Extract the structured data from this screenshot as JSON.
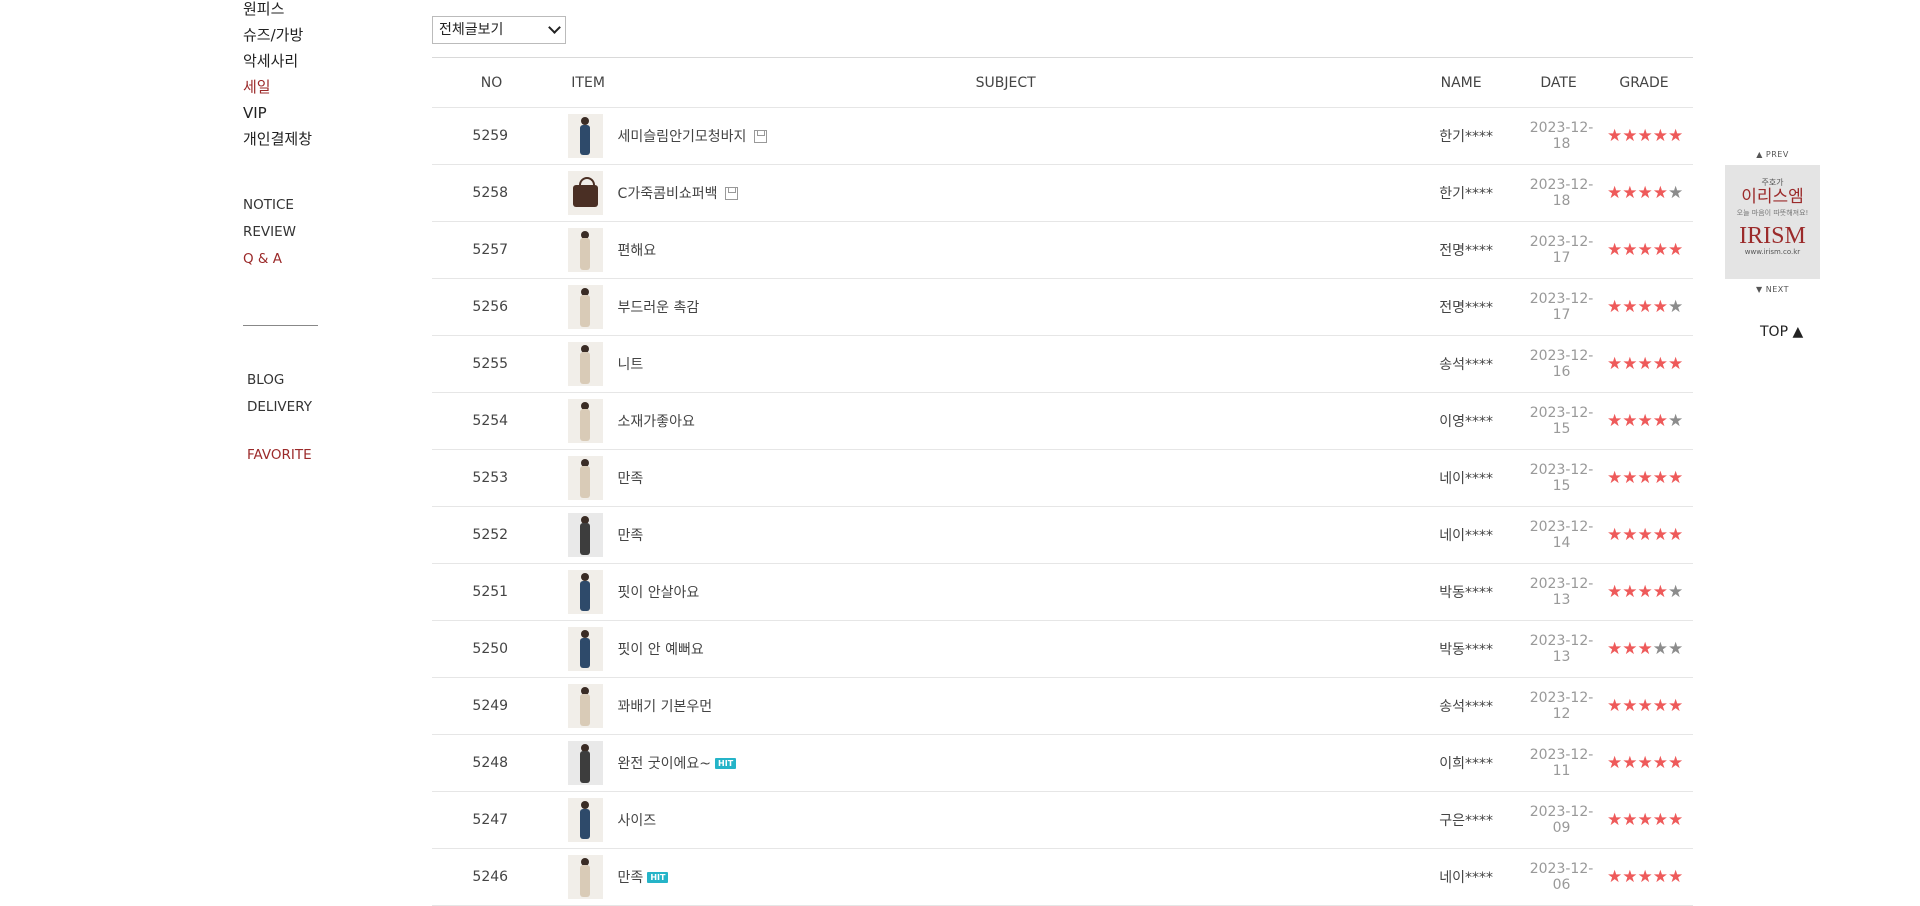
{
  "nav": {
    "categories": [
      {
        "label": "원피스",
        "highlight": false
      },
      {
        "label": "슈즈/가방",
        "highlight": false
      },
      {
        "label": "악세사리",
        "highlight": false
      },
      {
        "label": "세일",
        "highlight": true
      },
      {
        "label": "VIP",
        "highlight": false
      },
      {
        "label": "개인결제창",
        "highlight": false
      }
    ],
    "board_links": [
      {
        "label": "NOTICE",
        "highlight": false
      },
      {
        "label": "REVIEW",
        "highlight": false
      },
      {
        "label": "Q & A",
        "highlight": true
      }
    ],
    "extra_links": [
      "BLOG",
      "DELIVERY"
    ],
    "favorite": "FAVORITE"
  },
  "filter": {
    "selected": "전체글보기"
  },
  "table": {
    "headers": {
      "no": "NO",
      "item": "ITEM",
      "subject": "SUBJECT",
      "name": "NAME",
      "date": "DATE",
      "grade": "GRADE"
    },
    "rows": [
      {
        "no": "5259",
        "thumb": "pants",
        "subject": "세미슬림안기모청바지",
        "file": true,
        "hit": false,
        "name": "한기****",
        "date": "2023-12-18",
        "rating": 5
      },
      {
        "no": "5258",
        "thumb": "bag",
        "subject": "C가죽콤비쇼퍼백",
        "file": true,
        "hit": false,
        "name": "한기****",
        "date": "2023-12-18",
        "rating": 4
      },
      {
        "no": "5257",
        "thumb": "beige",
        "subject": "편해요",
        "file": false,
        "hit": false,
        "name": "전명****",
        "date": "2023-12-17",
        "rating": 5
      },
      {
        "no": "5256",
        "thumb": "beige",
        "subject": "부드러운 촉감",
        "file": false,
        "hit": false,
        "name": "전명****",
        "date": "2023-12-17",
        "rating": 4
      },
      {
        "no": "5255",
        "thumb": "beige",
        "subject": "니트",
        "file": false,
        "hit": false,
        "name": "송석****",
        "date": "2023-12-16",
        "rating": 5
      },
      {
        "no": "5254",
        "thumb": "beige",
        "subject": "소재가좋아요",
        "file": false,
        "hit": false,
        "name": "이영****",
        "date": "2023-12-15",
        "rating": 4
      },
      {
        "no": "5253",
        "thumb": "beige",
        "subject": "만족",
        "file": false,
        "hit": false,
        "name": "네이****",
        "date": "2023-12-15",
        "rating": 5
      },
      {
        "no": "5252",
        "thumb": "dark",
        "subject": "만족",
        "file": false,
        "hit": false,
        "name": "네이****",
        "date": "2023-12-14",
        "rating": 5
      },
      {
        "no": "5251",
        "thumb": "pants",
        "subject": "핏이 안살아요",
        "file": false,
        "hit": false,
        "name": "박동****",
        "date": "2023-12-13",
        "rating": 4
      },
      {
        "no": "5250",
        "thumb": "pants",
        "subject": "핏이 안 예뻐요",
        "file": false,
        "hit": false,
        "name": "박동****",
        "date": "2023-12-13",
        "rating": 3
      },
      {
        "no": "5249",
        "thumb": "beige",
        "subject": "꽈배기 기본우먼",
        "file": false,
        "hit": false,
        "name": "송석****",
        "date": "2023-12-12",
        "rating": 5
      },
      {
        "no": "5248",
        "thumb": "dark",
        "subject": "완전 굿이에요~",
        "file": false,
        "hit": true,
        "name": "이희****",
        "date": "2023-12-11",
        "rating": 5
      },
      {
        "no": "5247",
        "thumb": "pants",
        "subject": "사이즈",
        "file": false,
        "hit": false,
        "name": "구은****",
        "date": "2023-12-09",
        "rating": 5
      },
      {
        "no": "5246",
        "thumb": "beige",
        "subject": "만족",
        "file": false,
        "hit": true,
        "name": "네이****",
        "date": "2023-12-06",
        "rating": 5
      }
    ],
    "hit_label": "HIT"
  },
  "side_widget": {
    "prev": "▲ PREV",
    "next": "▼ NEXT",
    "banner_line1": "주호가",
    "banner_line2": "이리스엠",
    "banner_line3": "오늘 마음이 따뜻해져요!",
    "banner_logo": "IRISM",
    "banner_url": "www.irism.co.kr",
    "top_label": "TOP ▲"
  },
  "colors": {
    "accent": "#9b2a2a",
    "star_on": "#ee5a5a",
    "star_off": "#8c8c8c",
    "hit": "#25b4c8"
  }
}
